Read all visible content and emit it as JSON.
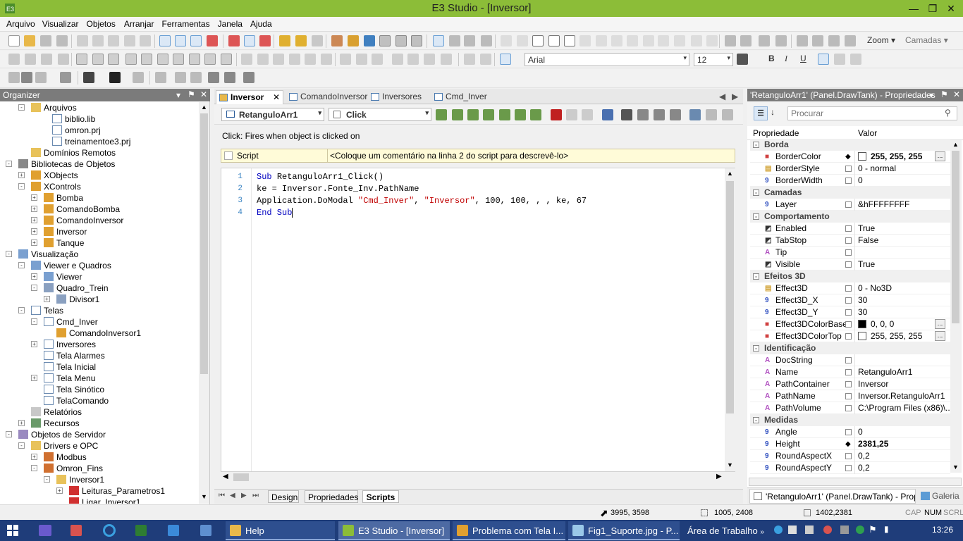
{
  "window": {
    "title": "E3 Studio - [Inversor]"
  },
  "menu": [
    "Arquivo",
    "Visualizar",
    "Objetos",
    "Arranjar",
    "Ferramentas",
    "Janela",
    "Ajuda"
  ],
  "toolbar": {
    "zoom_label": "Zoom",
    "layers_label": "Camadas",
    "font_name": "Arial",
    "font_size": "12",
    "bold": "B",
    "italic": "I",
    "underline": "U"
  },
  "organizer": {
    "title": "Organizer",
    "nodes": [
      {
        "label": "Arquivos",
        "icon": "folder-icon"
      },
      {
        "label": "biblio.lib",
        "icon": "file-icon"
      },
      {
        "label": "omron.prj",
        "icon": "file-icon"
      },
      {
        "label": "treinamentoe3.prj",
        "icon": "file-icon"
      },
      {
        "label": "Domínios Remotos",
        "icon": "folder-icon"
      },
      {
        "label": "Bibliotecas de Objetos",
        "icon": "library-icon"
      },
      {
        "label": "XObjects",
        "icon": "xobject-icon"
      },
      {
        "label": "XControls",
        "icon": "xobject-icon"
      },
      {
        "label": "Bomba",
        "icon": "xobject-icon"
      },
      {
        "label": "ComandoBomba",
        "icon": "xobject-icon"
      },
      {
        "label": "ComandoInversor",
        "icon": "xobject-icon"
      },
      {
        "label": "Inversor",
        "icon": "xobject-icon"
      },
      {
        "label": "Tanque",
        "icon": "xobject-icon"
      },
      {
        "label": "Visualização",
        "icon": "monitor-icon"
      },
      {
        "label": "Viewer e Quadros",
        "icon": "monitor-icon"
      },
      {
        "label": "Viewer",
        "icon": "monitor-icon"
      },
      {
        "label": "Quadro_Trein",
        "icon": "frame-icon"
      },
      {
        "label": "Divisor1",
        "icon": "frame-icon"
      },
      {
        "label": "Telas",
        "icon": "screen-icon"
      },
      {
        "label": "Cmd_Inver",
        "icon": "screen-icon"
      },
      {
        "label": "ComandoInversor1",
        "icon": "xobject-icon"
      },
      {
        "label": "Inversores",
        "icon": "screen-icon"
      },
      {
        "label": "Tela Alarmes",
        "icon": "screen-icon"
      },
      {
        "label": "Tela Inicial",
        "icon": "screen-icon"
      },
      {
        "label": "Tela Menu",
        "icon": "screen-icon"
      },
      {
        "label": "Tela Sinótico",
        "icon": "screen-icon"
      },
      {
        "label": "TelaComando",
        "icon": "screen-icon"
      },
      {
        "label": "Relatórios",
        "icon": "report-icon"
      },
      {
        "label": "Recursos",
        "icon": "resource-icon"
      },
      {
        "label": "Objetos de Servidor",
        "icon": "server-icon"
      },
      {
        "label": "Drivers e OPC",
        "icon": "folder-icon"
      },
      {
        "label": "Modbus",
        "icon": "driver-icon"
      },
      {
        "label": "Omron_Fins",
        "icon": "driver-icon"
      },
      {
        "label": "Inversor1",
        "icon": "folder-icon"
      },
      {
        "label": "Leituras_Parametros1",
        "icon": "tag-icon"
      },
      {
        "label": "Ligar_Inversor1",
        "icon": "tag-icon"
      }
    ]
  },
  "editor": {
    "tabs": [
      "Inversor",
      "ComandoInversor",
      "Inversores",
      "Cmd_Inver"
    ],
    "object_combo": "RetanguloArr1",
    "event_combo": "Click",
    "event_desc": "Click: Fires when object is clicked on",
    "script_label": "Script",
    "script_comment": "<Coloque um comentário na linha 2 do script para descrevê-lo>",
    "lines": [
      {
        "n": "1",
        "parts": [
          [
            "kw",
            "Sub "
          ],
          [
            "",
            "RetanguloArr1_Click()"
          ]
        ]
      },
      {
        "n": "2",
        "parts": [
          [
            "",
            "ke = Inversor.Fonte_Inv.PathName"
          ]
        ]
      },
      {
        "n": "3",
        "parts": [
          [
            "",
            "Application.DoModal "
          ],
          [
            "str",
            "\"Cmd_Inver\""
          ],
          [
            "",
            ", "
          ],
          [
            "str",
            "\"Inversor\""
          ],
          [
            "",
            ", 100, 100, , , ke, 67"
          ]
        ]
      },
      {
        "n": "4",
        "parts": [
          [
            "kw",
            "End Sub"
          ]
        ]
      }
    ],
    "bottom_tabs": [
      "Design",
      "Propriedades",
      "Scripts"
    ]
  },
  "properties": {
    "title": "'RetanguloArr1' (Panel.DrawTank) - Propriedades",
    "search_placeholder": "Procurar",
    "col_name": "Propriedade",
    "col_value": "Valor",
    "rows": [
      {
        "cat": "Borda"
      },
      {
        "name": "BorderColor",
        "icon": "color-icon",
        "value": "255, 255, 255",
        "swatch": "#ffffff",
        "bold": true,
        "ellipsis": true,
        "flag": "diamond"
      },
      {
        "name": "BorderStyle",
        "icon": "enum-icon",
        "value": "0 - normal"
      },
      {
        "name": "BorderWidth",
        "icon": "number-icon",
        "value": "0"
      },
      {
        "cat": "Camadas"
      },
      {
        "name": "Layer",
        "icon": "number-icon",
        "value": "&hFFFFFFFF"
      },
      {
        "cat": "Comportamento"
      },
      {
        "name": "Enabled",
        "icon": "bool-icon",
        "value": "True"
      },
      {
        "name": "TabStop",
        "icon": "bool-icon",
        "value": "False"
      },
      {
        "name": "Tip",
        "icon": "text-icon",
        "value": ""
      },
      {
        "name": "Visible",
        "icon": "bool-icon",
        "value": "True"
      },
      {
        "cat": "Efeitos 3D"
      },
      {
        "name": "Effect3D",
        "icon": "enum-icon",
        "value": "0 - No3D"
      },
      {
        "name": "Effect3D_X",
        "icon": "number-icon",
        "value": "30"
      },
      {
        "name": "Effect3D_Y",
        "icon": "number-icon",
        "value": "30"
      },
      {
        "name": "Effect3DColorBase",
        "icon": "color-icon",
        "value": "0, 0, 0",
        "swatch": "#000000",
        "ellipsis": true
      },
      {
        "name": "Effect3DColorTop",
        "icon": "color-icon",
        "value": "255, 255, 255",
        "swatch": "#ffffff",
        "ellipsis": true
      },
      {
        "cat": "Identificação"
      },
      {
        "name": "DocString",
        "icon": "text-icon",
        "value": ""
      },
      {
        "name": "Name",
        "icon": "text-icon",
        "value": "RetanguloArr1"
      },
      {
        "name": "PathContainer",
        "icon": "text-icon",
        "value": "Inversor"
      },
      {
        "name": "PathName",
        "icon": "text-icon",
        "value": "Inversor.RetanguloArr1"
      },
      {
        "name": "PathVolume",
        "icon": "text-icon",
        "value": "C:\\Program Files (x86)\\..."
      },
      {
        "cat": "Medidas"
      },
      {
        "name": "Angle",
        "icon": "number-icon",
        "value": "0"
      },
      {
        "name": "Height",
        "icon": "number-icon",
        "value": "2381,25",
        "bold": true,
        "flag": "diamond"
      },
      {
        "name": "RoundAspectX",
        "icon": "number-icon",
        "value": "0,2"
      },
      {
        "name": "RoundAspectY",
        "icon": "number-icon",
        "value": "0,2"
      }
    ],
    "bottom_tab": "'RetanguloArr1' (Panel.DrawTank) - Propri...",
    "gallery_tab": "Galeria"
  },
  "status": {
    "cursor": "3995, 3598",
    "position": "1005, 2408",
    "size": "1402,2381",
    "caps": "CAP",
    "num": "NUM",
    "scrl": "SCRL"
  },
  "taskbar": {
    "buttons": [
      "Help",
      "E3 Studio - [Inversor]",
      "Problema com Tela I...",
      "Fig1_Suporte.jpg - P..."
    ],
    "desktop": "Área de Trabalho",
    "clock": "13:26"
  }
}
